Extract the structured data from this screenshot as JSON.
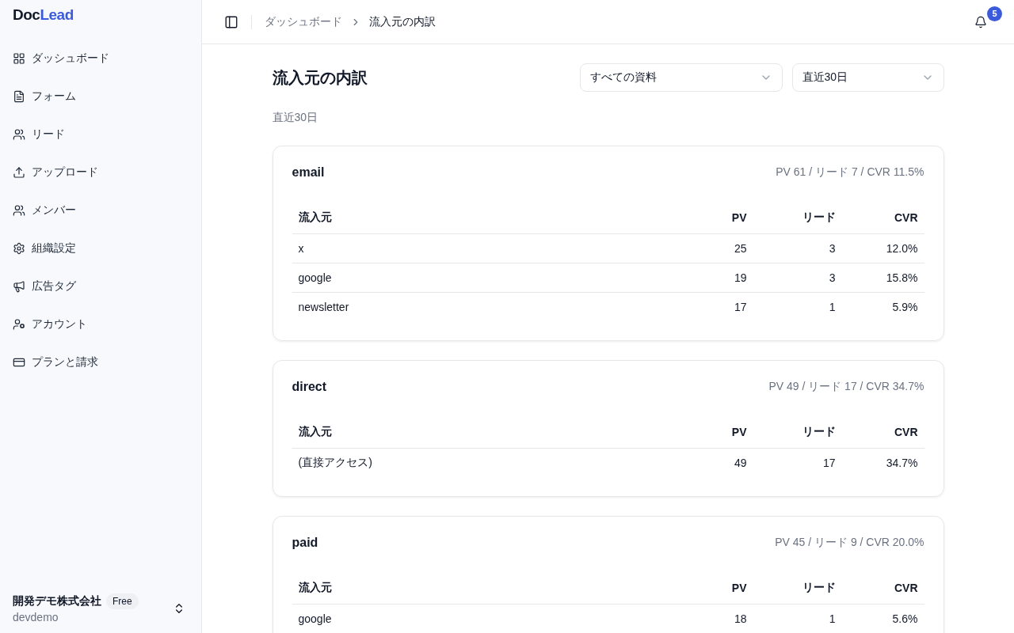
{
  "sidebar": {
    "logo": {
      "part_1": "Doc",
      "part_2": "Lead"
    },
    "items": [
      {
        "label": "ダッシュボード"
      },
      {
        "label": "フォーム"
      },
      {
        "label": "リード"
      },
      {
        "label": "アップロード"
      },
      {
        "label": "メンバー"
      },
      {
        "label": "組織設定"
      },
      {
        "label": "広告タグ"
      },
      {
        "label": "アカウント"
      },
      {
        "label": "プランと請求"
      }
    ],
    "org": {
      "name": "開発デモ株式会社",
      "plan": "Free",
      "slug": "devdemo"
    }
  },
  "header": {
    "breadcrumb": [
      "ダッシュボード",
      "流入元の内訳"
    ],
    "notifications": "5"
  },
  "page": {
    "title": "流入元の内訳",
    "filters": [
      "すべての資料",
      "直近30日"
    ],
    "period": "直近30日"
  },
  "cards": [
    {
      "title": "email",
      "summary": "PV 61 / リード 7 / CVR 11.5%",
      "columns": [
        "流入元",
        "PV",
        "リード",
        "CVR"
      ],
      "rows": [
        [
          "x",
          "25",
          "3",
          "12.0%"
        ],
        [
          "google",
          "19",
          "3",
          "15.8%"
        ],
        [
          "newsletter",
          "17",
          "1",
          "5.9%"
        ]
      ]
    },
    {
      "title": "direct",
      "summary": "PV 49 / リード 17 / CVR 34.7%",
      "columns": [
        "流入元",
        "PV",
        "リード",
        "CVR"
      ],
      "rows": [
        [
          "(直接アクセス)",
          "49",
          "17",
          "34.7%"
        ]
      ]
    },
    {
      "title": "paid",
      "summary": "PV 45 / リード 9 / CVR 20.0%",
      "columns": [
        "流入元",
        "PV",
        "リード",
        "CVR"
      ],
      "rows": [
        [
          "google",
          "18",
          "1",
          "5.6%"
        ]
      ]
    }
  ]
}
